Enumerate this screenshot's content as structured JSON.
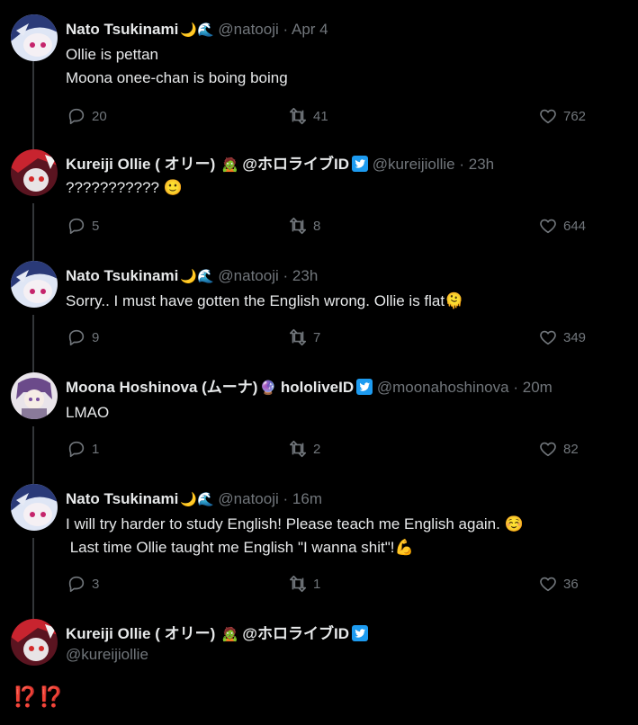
{
  "tweets": [
    {
      "name": "Nato Tsukinami",
      "handle": "@natooji",
      "time": "Apr 4",
      "lines": [
        "Ollie is pettan",
        "Moona onee-chan is boing boing"
      ],
      "replies": "20",
      "retweets": "41",
      "likes": "762",
      "avatar": "nato"
    },
    {
      "name": "Kureiji Ollie ( オリー)",
      "tag": "@ホロライブID",
      "handle": "@kureijiollie",
      "time": "23h",
      "lines": [
        "??????????? 🙂"
      ],
      "replies": "5",
      "retweets": "8",
      "likes": "644",
      "avatar": "ollie"
    },
    {
      "name": "Nato Tsukinami",
      "handle": "@natooji",
      "time": "23h",
      "lines": [
        "Sorry.. I must have gotten the English wrong.  Ollie is flat🫠"
      ],
      "replies": "9",
      "retweets": "7",
      "likes": "349",
      "avatar": "nato"
    },
    {
      "name": "Moona Hoshinova (ムーナ)",
      "tag": "hololiveID",
      "handle": "@moonahoshinova",
      "time": "20m",
      "lines": [
        "LMAO"
      ],
      "replies": "1",
      "retweets": "2",
      "likes": "82",
      "avatar": "moona"
    },
    {
      "name": "Nato Tsukinami",
      "handle": "@natooji",
      "time": "16m",
      "lines": [
        "I will try harder to study English! Please teach me English again. ☺️",
        " Last time Ollie taught me English \"I wanna shit\"!💪"
      ],
      "replies": "3",
      "retweets": "1",
      "likes": "36",
      "avatar": "nato"
    }
  ],
  "last_tweet": {
    "name": "Kureiji Ollie ( オリー)",
    "tag": "@ホロライブID",
    "handle": "@kureijiollie",
    "text": "⁉️⁉️"
  },
  "separator": "·",
  "colors": {
    "background": "#000000",
    "text": "#e7e9ea",
    "muted": "#71767b",
    "verified": "#1d9bf0",
    "line": "#333639"
  }
}
